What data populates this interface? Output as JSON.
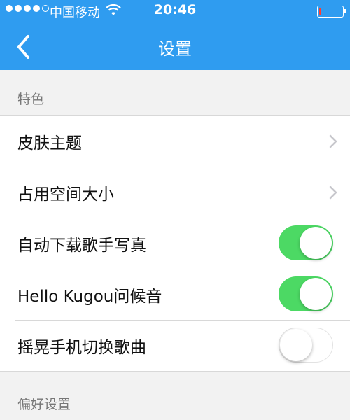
{
  "status_bar": {
    "carrier": "中国移动",
    "time": "20:46",
    "signal_strength": 4,
    "battery_level": 0.1,
    "battery_color": "#ff3b30"
  },
  "nav": {
    "title": "设置",
    "back_icon": "chevron-left-icon",
    "background": "#2f9cf0"
  },
  "sections": [
    {
      "header": "特色",
      "items": [
        {
          "label": "皮肤主题",
          "control": "disclosure",
          "icon": "chevron-right-icon"
        },
        {
          "label": "占用空间大小",
          "control": "disclosure",
          "icon": "chevron-right-icon"
        },
        {
          "label": "自动下载歌手写真",
          "control": "toggle",
          "on": true
        },
        {
          "label": "Hello Kugou问候音",
          "control": "toggle",
          "on": true
        },
        {
          "label": "摇晃手机切换歌曲",
          "control": "toggle",
          "on": false
        }
      ]
    },
    {
      "header": "偏好设置",
      "items": []
    }
  ],
  "colors": {
    "toggle_on": "#4cd964",
    "section_text": "#777777"
  }
}
